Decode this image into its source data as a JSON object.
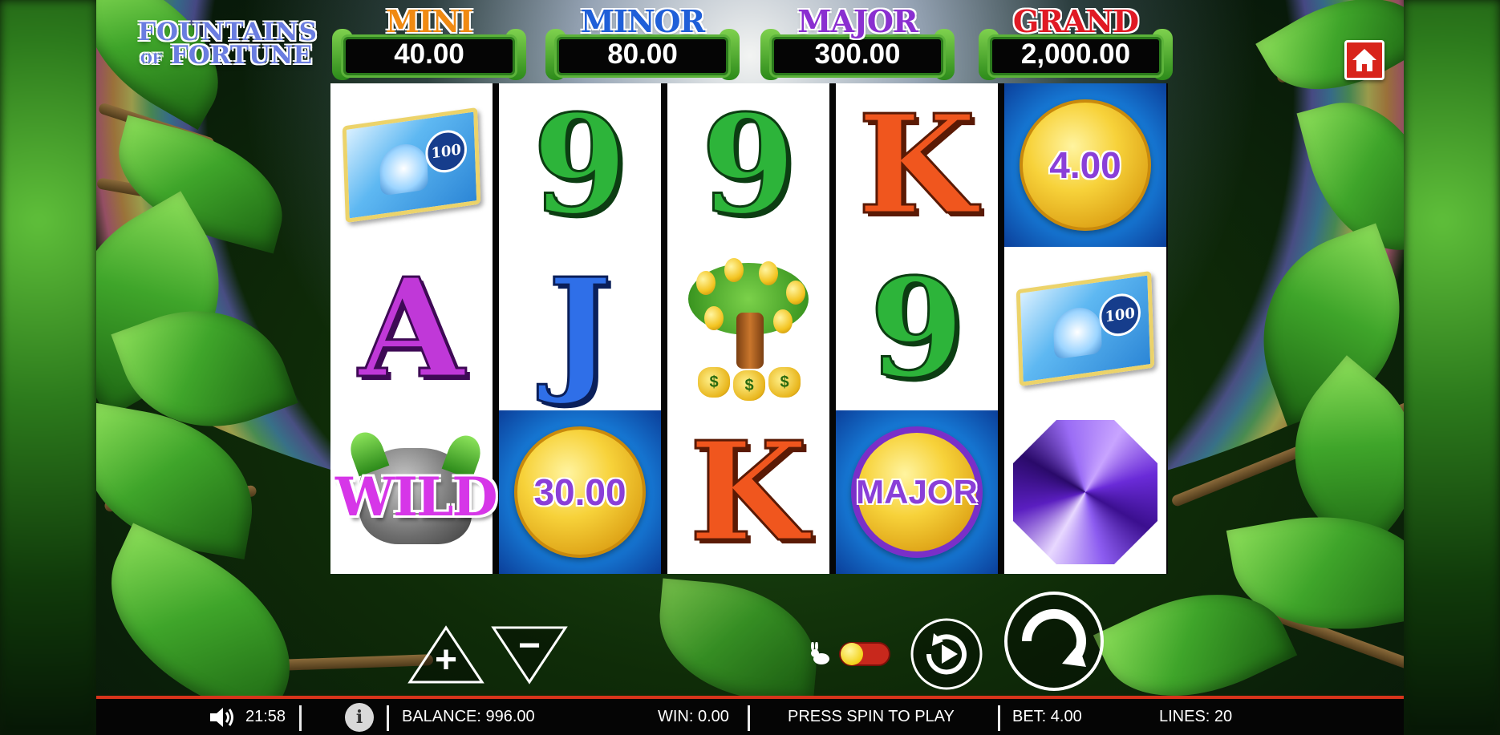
{
  "logo": {
    "line1": "FOUNTAINS",
    "line2_small": "OF",
    "line2": "FORTUNE"
  },
  "jackpots": [
    {
      "title": "MINI",
      "value": "40.00",
      "color": "#f08a12"
    },
    {
      "title": "MINOR",
      "value": "80.00",
      "color": "#1f5fd8"
    },
    {
      "title": "MAJOR",
      "value": "300.00",
      "color": "#8a2fd0"
    },
    {
      "title": "GRAND",
      "value": "2,000.00",
      "color": "#e01a24"
    }
  ],
  "home_button": {
    "icon": "home-icon",
    "color": "#d8241b"
  },
  "reels": [
    [
      {
        "symbol": "banknote",
        "value": "100"
      },
      {
        "symbol": "letter",
        "value": "A"
      },
      {
        "symbol": "wild",
        "value": "WILD"
      }
    ],
    [
      {
        "symbol": "letter",
        "value": "9"
      },
      {
        "symbol": "letter",
        "value": "J"
      },
      {
        "symbol": "coin",
        "value": "30.00"
      }
    ],
    [
      {
        "symbol": "letter",
        "value": "9"
      },
      {
        "symbol": "money-tree",
        "value": "$"
      },
      {
        "symbol": "letter",
        "value": "K"
      }
    ],
    [
      {
        "symbol": "letter",
        "value": "K"
      },
      {
        "symbol": "letter",
        "value": "9"
      },
      {
        "symbol": "coin-major",
        "value": "MAJOR"
      }
    ],
    [
      {
        "symbol": "coin",
        "value": "4.00"
      },
      {
        "symbol": "banknote",
        "value": "100"
      },
      {
        "symbol": "gem",
        "value": ""
      }
    ]
  ],
  "controls": {
    "bet_increase": "+",
    "bet_decrease": "−",
    "turbo_toggle": {
      "icon": "rabbit-icon",
      "state": "off"
    },
    "autoplay": {
      "icon": "autoplay-icon"
    },
    "spin": {
      "icon": "spin-icon"
    }
  },
  "status_bar": {
    "time": "21:58",
    "info": "i",
    "balance": "BALANCE: 996.00",
    "win": "WIN: 0.00",
    "message": "PRESS SPIN TO PLAY",
    "bet": "BET: 4.00",
    "lines": "LINES: 20"
  }
}
